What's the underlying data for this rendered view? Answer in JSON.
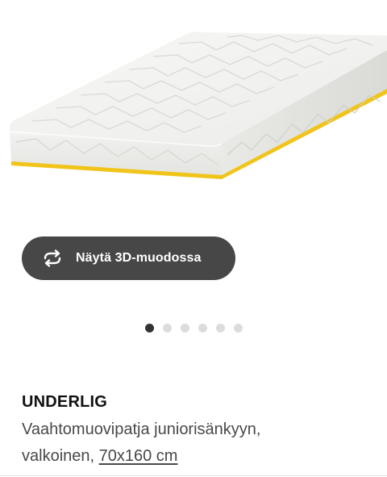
{
  "hero": {
    "image_alt": "mattress-product-image",
    "colors": {
      "foam": "#f4f4f2",
      "foam_shadow": "#e2e2df",
      "base_stripe": "#f0c419"
    }
  },
  "view3d": {
    "label": "Näytä 3D-muodossa",
    "icon": "rotate-3d-icon",
    "background": "#474747"
  },
  "carousel": {
    "total_slides": 6,
    "active_index": 0
  },
  "product": {
    "name": "UNDERLIG",
    "description_line1": "Vaahtomuovipatja juniorisänkyyn,",
    "description_prefix": "valkoinen, ",
    "size": "70x160 cm"
  }
}
